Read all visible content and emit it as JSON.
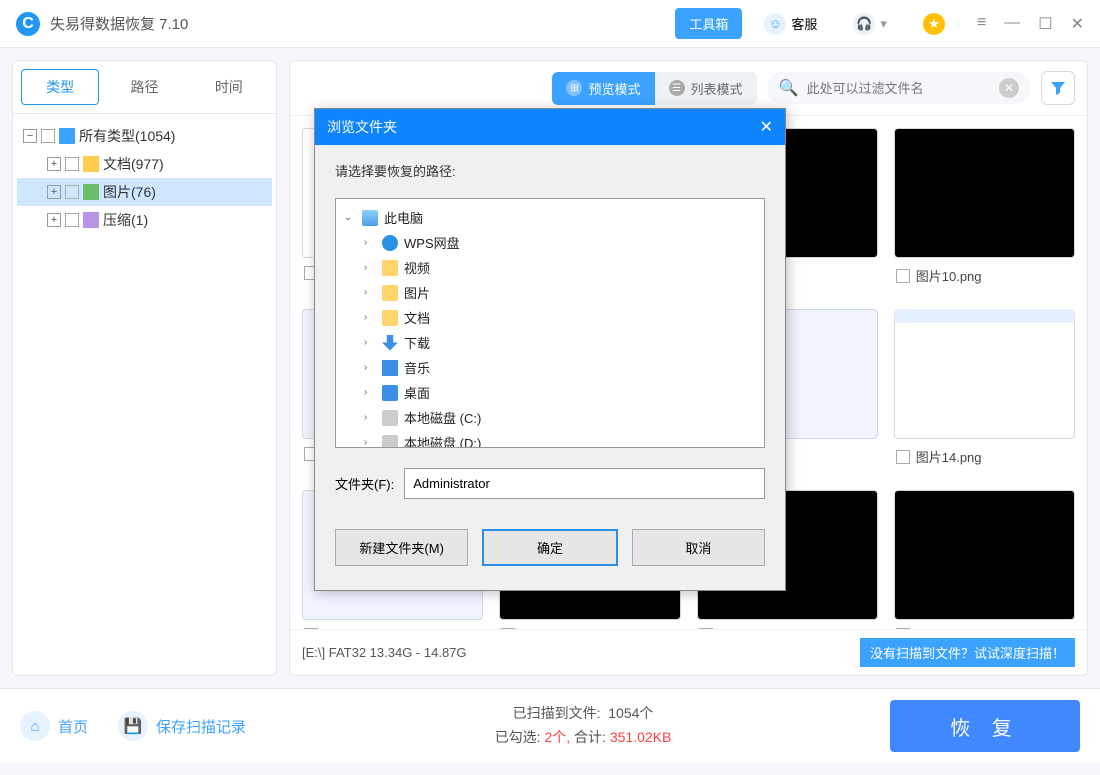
{
  "app": {
    "title": "失易得数据恢复 7.10"
  },
  "titlebar": {
    "toolbox": "工具箱",
    "support": "客服"
  },
  "sidebar": {
    "tabs": {
      "type": "类型",
      "path": "路径",
      "time": "时间"
    },
    "tree": {
      "all": "所有类型(1054)",
      "doc": "文档(977)",
      "img": "图片(76)",
      "zip": "压缩(1)"
    }
  },
  "toolbar": {
    "preview": "预览模式",
    "list": "列表模式",
    "search_placeholder": "此处可以过滤文件名"
  },
  "thumbs": {
    "t10": "图片10.png",
    "t14": "图片14.png"
  },
  "status": {
    "path": "[E:\\] FAT32 13.34G - 14.87G",
    "deep": "没有扫描到文件？试试深度扫描！"
  },
  "footer": {
    "home": "首页",
    "save": "保存扫描记录",
    "scanned_label": "已扫描到文件:",
    "scanned_count": "1054个",
    "selected_label": "已勾选:",
    "selected_count": "2个,",
    "total_label": "合计:",
    "total_size": "351.02KB",
    "recover": "恢 复"
  },
  "modal": {
    "title": "浏览文件夹",
    "prompt": "请选择要恢复的路径:",
    "tree": {
      "root": "此电脑",
      "wps": "WPS网盘",
      "video": "视频",
      "pic": "图片",
      "doc": "文档",
      "dl": "下载",
      "music": "音乐",
      "desktop": "桌面",
      "diskc": "本地磁盘 (C:)",
      "diskd": "本地磁盘 (D:)"
    },
    "folder_label": "文件夹(F):",
    "folder_value": "Administrator",
    "new_folder": "新建文件夹(M)",
    "ok": "确定",
    "cancel": "取消"
  }
}
